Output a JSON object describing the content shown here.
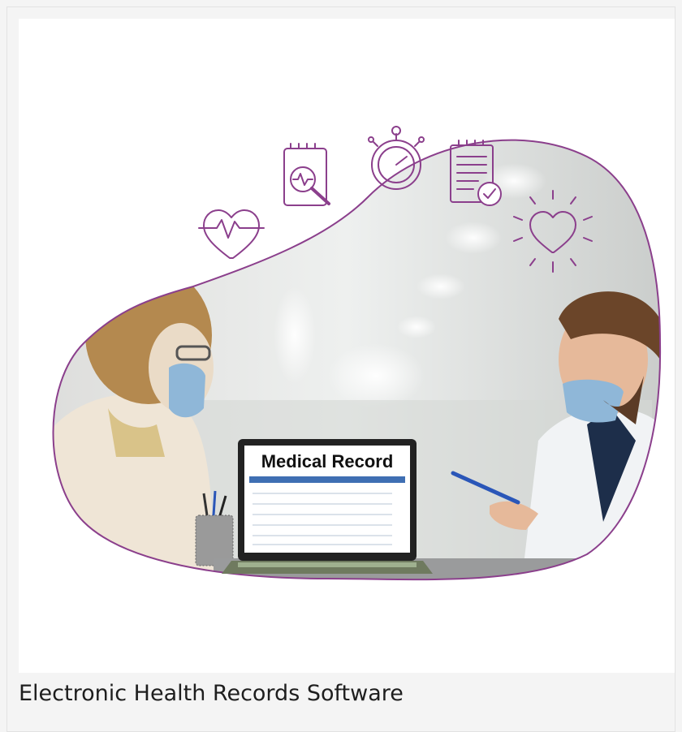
{
  "card": {
    "caption": "Electronic Health Records Software",
    "image": {
      "alt_icons": [
        "heartbeat-icon",
        "report-search-icon",
        "stopwatch-icon",
        "checklist-icon",
        "heart-glow-icon"
      ],
      "laptop_screen": {
        "title": "Medical Record"
      }
    }
  },
  "colors": {
    "accent": "#8b3f8c",
    "screen_header": "#3f6fb3"
  }
}
